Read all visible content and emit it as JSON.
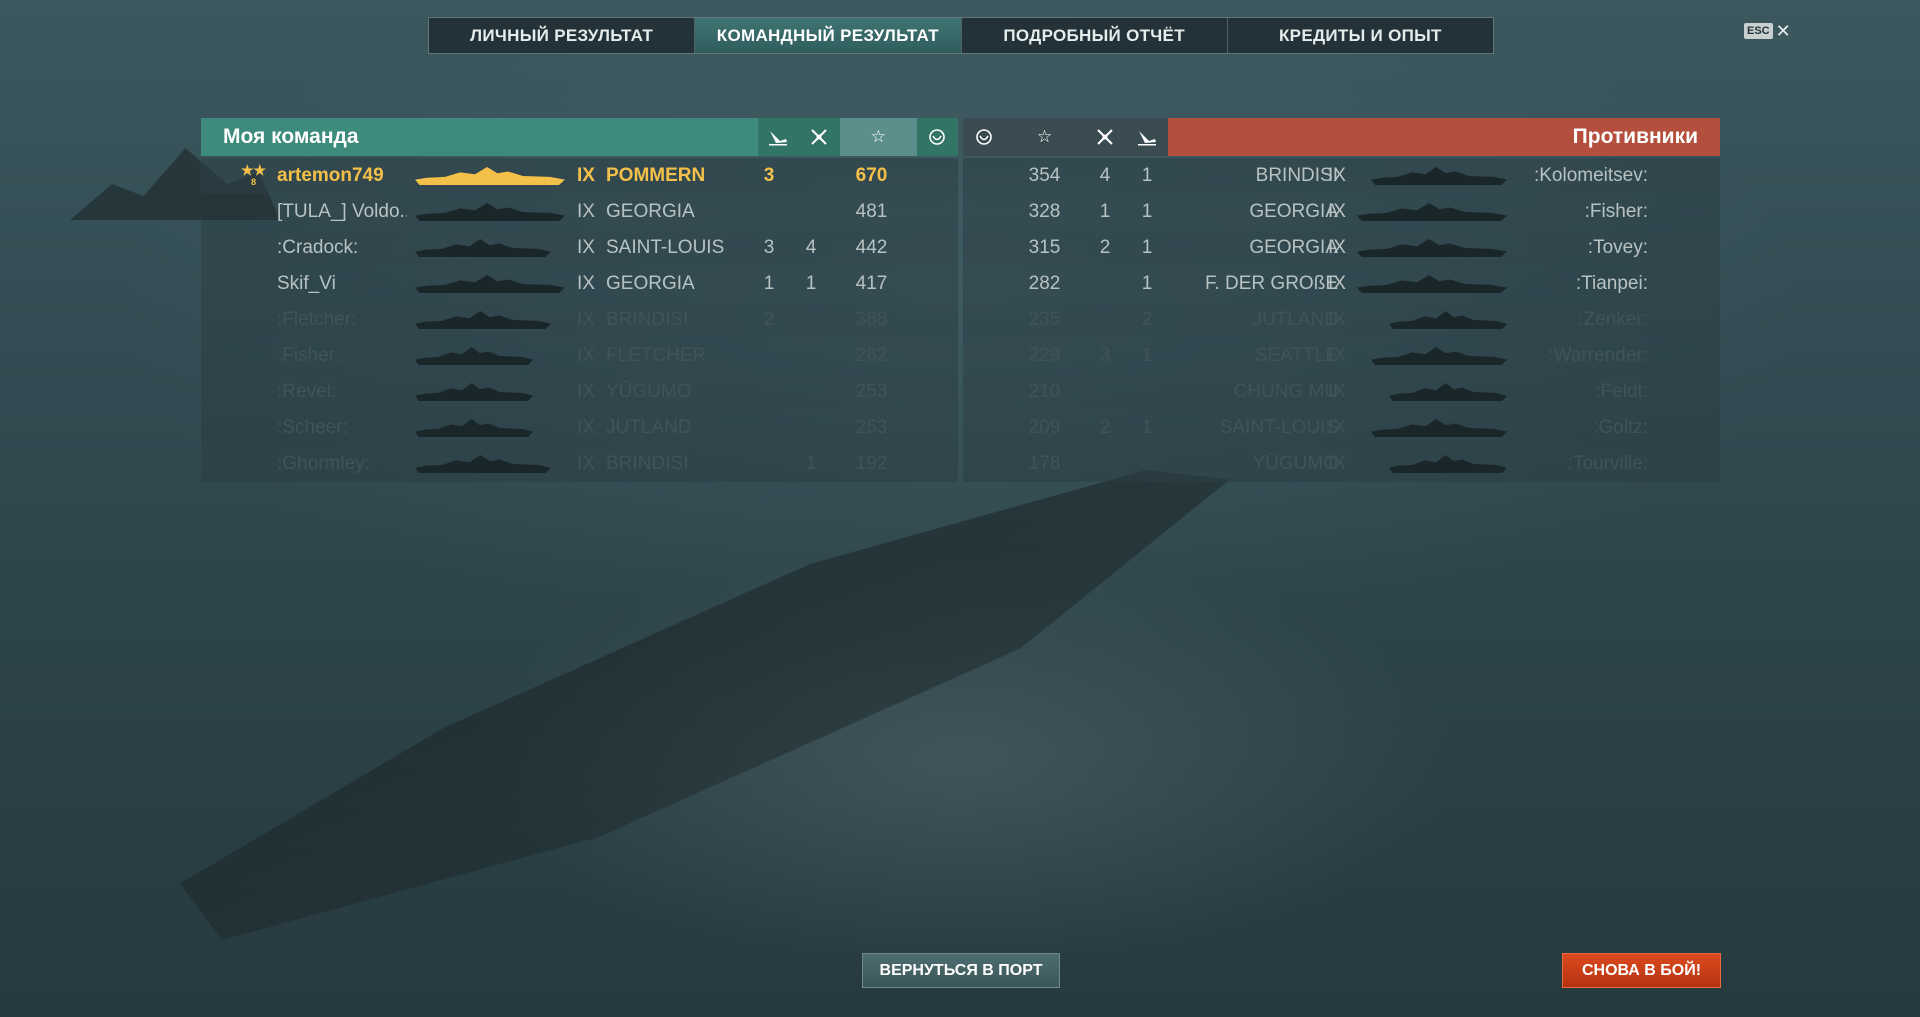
{
  "tabs": [
    {
      "label": "ЛИЧНЫЙ РЕЗУЛЬТАТ"
    },
    {
      "label": "КОМАНДНЫЙ РЕЗУЛЬТАТ",
      "active": true
    },
    {
      "label": "ПОДРОБНЫЙ ОТЧЁТ"
    },
    {
      "label": "КРЕДИТЫ И ОПЫТ"
    }
  ],
  "esc": {
    "label": "ESC",
    "close": "✕"
  },
  "my_team": {
    "title": "Моя команда",
    "columns": {
      "ships_sunk": "ships-sunk-icon",
      "planes": "planes-icon",
      "score": "☆",
      "base": "base-capture-icon"
    },
    "rows": [
      {
        "name": "artemon749",
        "tier": "IX",
        "ship": "POMMERN",
        "sunk": "3",
        "planes": "",
        "score": "670",
        "me": true,
        "rank": "8"
      },
      {
        "name": "[TULA_] Voldo...",
        "tier": "IX",
        "ship": "GEORGIA",
        "sunk": "",
        "planes": "",
        "score": "481"
      },
      {
        "name": ":Cradock:",
        "tier": "IX",
        "ship": "SAINT-LOUIS",
        "sunk": "3",
        "planes": "4",
        "score": "442"
      },
      {
        "name": "Skif_Vi",
        "tier": "IX",
        "ship": "GEORGIA",
        "sunk": "1",
        "planes": "1",
        "score": "417"
      },
      {
        "name": ":Fletcher:",
        "tier": "IX",
        "ship": "BRINDISI",
        "sunk": "2",
        "planes": "",
        "score": "388"
      },
      {
        "name": ":Fisher:",
        "tier": "IX",
        "ship": "FLETCHER",
        "sunk": "",
        "planes": "",
        "score": "262"
      },
      {
        "name": ":Revel:",
        "tier": "IX",
        "ship": "YŪGUMO",
        "sunk": "",
        "planes": "",
        "score": "253"
      },
      {
        "name": ":Scheer:",
        "tier": "IX",
        "ship": "JUTLAND",
        "sunk": "",
        "planes": "",
        "score": "253"
      },
      {
        "name": ":Ghormley:",
        "tier": "IX",
        "ship": "BRINDISI",
        "sunk": "",
        "planes": "1",
        "score": "192"
      }
    ]
  },
  "enemy_team": {
    "title": "Противники",
    "rows": [
      {
        "score": "354",
        "planes": "4",
        "sunk": "1",
        "ship": "BRINDISI",
        "tier": "IX",
        "name": ":Kolomeitsev:"
      },
      {
        "score": "328",
        "planes": "1",
        "sunk": "1",
        "ship": "GEORGIA",
        "tier": "IX",
        "name": ":Fisher:"
      },
      {
        "score": "315",
        "planes": "2",
        "sunk": "1",
        "ship": "GEORGIA",
        "tier": "IX",
        "name": ":Tovey:"
      },
      {
        "score": "282",
        "planes": "",
        "sunk": "1",
        "ship": "F. DER GROßE",
        "tier": "IX",
        "name": ":Tianpei:"
      },
      {
        "score": "235",
        "planes": "",
        "sunk": "2",
        "ship": "JUTLAND",
        "tier": "IX",
        "name": ":Zenker:"
      },
      {
        "score": "229",
        "planes": "3",
        "sunk": "1",
        "ship": "SEATTLE",
        "tier": "IX",
        "name": ":Warrender:"
      },
      {
        "score": "210",
        "planes": "",
        "sunk": "",
        "ship": "CHUNG MU",
        "tier": "IX",
        "name": ":Feldt:"
      },
      {
        "score": "209",
        "planes": "2",
        "sunk": "1",
        "ship": "SAINT-LOUIS",
        "tier": "IX",
        "name": ":Goltz:"
      },
      {
        "score": "178",
        "planes": "",
        "sunk": "",
        "ship": "YŪGUMO",
        "tier": "IX",
        "name": ":Tourville:"
      }
    ]
  },
  "buttons": {
    "return_port": "ВЕРНУТЬСЯ В ПОРТ",
    "battle_again": "СНОВА В БОЙ!"
  },
  "colors": {
    "ally": "#3d8b7c",
    "enemy": "#b34f3c",
    "highlight": "#f3c049",
    "battle_button": "#dc4a1f"
  }
}
